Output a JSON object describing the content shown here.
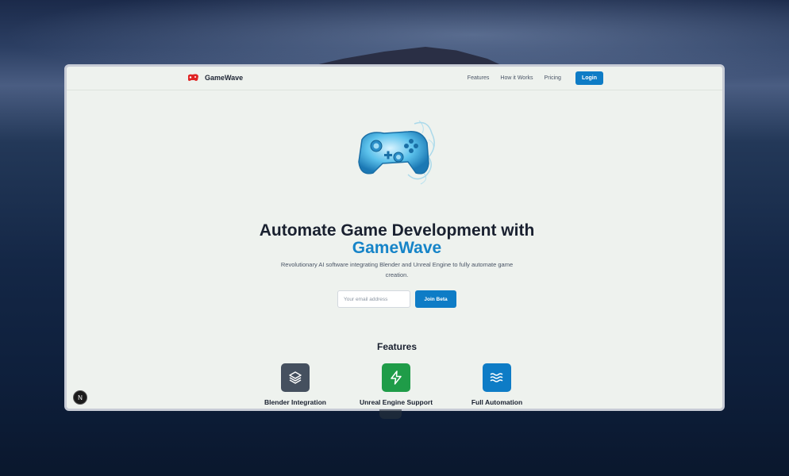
{
  "brand": {
    "name": "GameWave",
    "logo_icon": "red-gamepad-logo"
  },
  "nav": {
    "links": [
      "Features",
      "How it Works",
      "Pricing"
    ],
    "login_label": "Login"
  },
  "hero": {
    "image_icon": "water-gamepad-illustration",
    "title_line1": "Automate Game Development with",
    "title_accent": "GameWave",
    "subtitle": "Revolutionary AI software integrating Blender and Unreal Engine to fully automate game creation.",
    "email_placeholder": "Your email address",
    "cta_label": "Join Beta"
  },
  "features": {
    "title": "Features",
    "items": [
      {
        "label": "Blender Integration",
        "icon": "layers-icon",
        "color": "#45505f"
      },
      {
        "label": "Unreal Engine Support",
        "icon": "lightning-icon",
        "color": "#1f9c48"
      },
      {
        "label": "Full Automation",
        "icon": "waves-icon",
        "color": "#0e7cc6"
      }
    ]
  },
  "colors": {
    "accent": "#1684c8",
    "button": "#0e7cc6",
    "background": "#eef2ee"
  },
  "dev_badge": "N"
}
